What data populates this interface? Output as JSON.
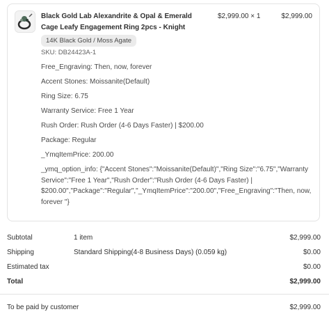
{
  "item": {
    "title": "Black Gold Lab Alexandrite & Opal & Emerald Cage Leafy Engagement Ring 2pcs - Knight",
    "unit_price": "$2,999.00 × 1",
    "line_total": "$2,999.00",
    "variant_badge": "14K Black Gold / Moss Agate",
    "sku": "SKU: DB24423A-1",
    "properties": [
      "Free_Engraving: Then, now, forever",
      "Accent Stones: Moissanite(Default)",
      "Ring Size: 6.75",
      "Warranty Service: Free 1 Year",
      "Rush Order: Rush Order (4-6 Days Faster) | $200.00",
      "Package: Regular",
      "_YmqItemPrice: 200.00",
      "_ymq_option_info: {\"Accent Stones\":\"Moissanite(Default)\",\"Ring Size\":\"6.75\",\"Warranty Service\":\"Free 1 Year\",\"Rush Order\":\"Rush Order (4-6 Days Faster) | $200.00\",\"Package\":\"Regular\",\"_YmqItemPrice\":\"200.00\",\"Free_Engraving\":\"Then, now, forever \"}"
    ],
    "thumbnail_icon": "ring-image-icon"
  },
  "summary": {
    "subtotal_label": "Subtotal",
    "subtotal_detail": "1 item",
    "subtotal_amount": "$2,999.00",
    "shipping_label": "Shipping",
    "shipping_detail": "Standard Shipping(4-8 Business Days) (0.059 kg)",
    "shipping_amount": "$0.00",
    "tax_label": "Estimated tax",
    "tax_amount": "$0.00",
    "total_label": "Total",
    "total_amount": "$2,999.00"
  },
  "footer": {
    "paid_label": "To be paid by customer",
    "paid_amount": "$2,999.00"
  }
}
